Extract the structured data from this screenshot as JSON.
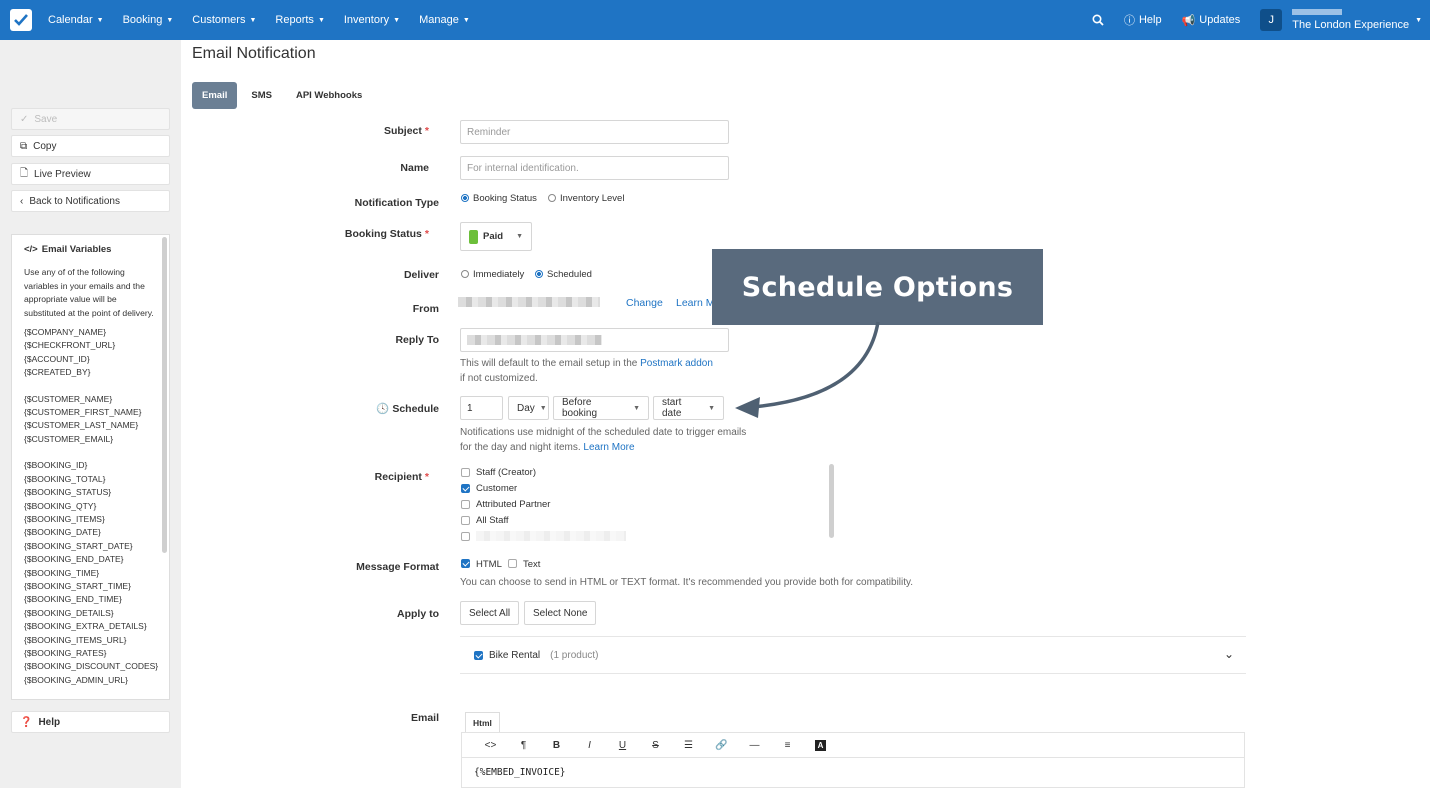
{
  "nav": {
    "items": [
      "Calendar",
      "Booking",
      "Customers",
      "Reports",
      "Inventory",
      "Manage"
    ],
    "help": "Help",
    "updates": "Updates",
    "avatar": "J",
    "account": "The London Experience"
  },
  "sidebar": {
    "save": "Save",
    "copy": "Copy",
    "live_preview": "Live Preview",
    "back": "Back to Notifications",
    "vars_title": "Email Variables",
    "vars_desc": "Use any of of the following variables in your emails and the appropriate value will be substituted at the point of delivery.",
    "var_groups": [
      [
        "{$COMPANY_NAME}",
        "{$CHECKFRONT_URL}",
        "{$ACCOUNT_ID}",
        "{$CREATED_BY}"
      ],
      [
        "{$CUSTOMER_NAME}",
        "{$CUSTOMER_FIRST_NAME}",
        "{$CUSTOMER_LAST_NAME}",
        "{$CUSTOMER_EMAIL}"
      ],
      [
        "{$BOOKING_ID}",
        "{$BOOKING_TOTAL}",
        "{$BOOKING_STATUS}",
        "{$BOOKING_QTY}",
        "{$BOOKING_ITEMS}",
        "{$BOOKING_DATE}",
        "{$BOOKING_START_DATE}",
        "{$BOOKING_END_DATE}",
        "{$BOOKING_TIME}",
        "{$BOOKING_START_TIME}",
        "{$BOOKING_END_TIME}",
        "{$BOOKING_DETAILS}",
        "{$BOOKING_EXTRA_DETAILS}",
        "{$BOOKING_ITEMS_URL}",
        "{$BOOKING_RATES}",
        "{$BOOKING_DISCOUNT_CODES}",
        "{$BOOKING_ADMIN_URL}"
      ]
    ],
    "help": "Help"
  },
  "page": {
    "title": "Email Notification",
    "tabs": [
      "Email",
      "SMS",
      "API Webhooks"
    ]
  },
  "form": {
    "subject_label": "Subject",
    "subject_value": "Reminder",
    "name_label": "Name",
    "name_placeholder": "For internal identification.",
    "type_label": "Notification Type",
    "type_options": [
      "Booking Status",
      "Inventory Level"
    ],
    "status_label": "Booking Status",
    "status_value": "Paid",
    "status_color": "#6cbf3a",
    "deliver_label": "Deliver",
    "deliver_options": [
      "Immediately",
      "Scheduled"
    ],
    "from_label": "From",
    "from_change": "Change",
    "from_learn": "Learn More",
    "reply_label": "Reply To",
    "reply_help_1": "This will default to the email setup in the",
    "reply_help_link": "Postmark addon",
    "reply_help_2": "if not customized.",
    "schedule_label": "Schedule",
    "schedule_num": "1",
    "schedule_unit": "Day",
    "schedule_when": "Before booking",
    "schedule_ref": "start date",
    "schedule_help_1": "Notifications use midnight of the scheduled date to trigger emails",
    "schedule_help_2": "for the day and night items.",
    "schedule_help_link": "Learn More",
    "recipient_label": "Recipient",
    "recipients": [
      {
        "label": "Staff (Creator)",
        "checked": false
      },
      {
        "label": "Customer",
        "checked": true
      },
      {
        "label": "Attributed Partner",
        "checked": false
      },
      {
        "label": "All Staff",
        "checked": false
      }
    ],
    "format_label": "Message Format",
    "format_options": [
      "HTML",
      "Text"
    ],
    "format_help": "You can choose to send in HTML or TEXT format. It's recommended you provide both for compatibility.",
    "apply_label": "Apply to",
    "select_all": "Select All",
    "select_none": "Select None",
    "product_name": "Bike Rental",
    "product_count": "(1 product)",
    "email_label": "Email",
    "editor_tab": "Html",
    "editor_content": "{%EMBED_INVOICE}"
  },
  "callout": {
    "text": "Schedule Options"
  }
}
